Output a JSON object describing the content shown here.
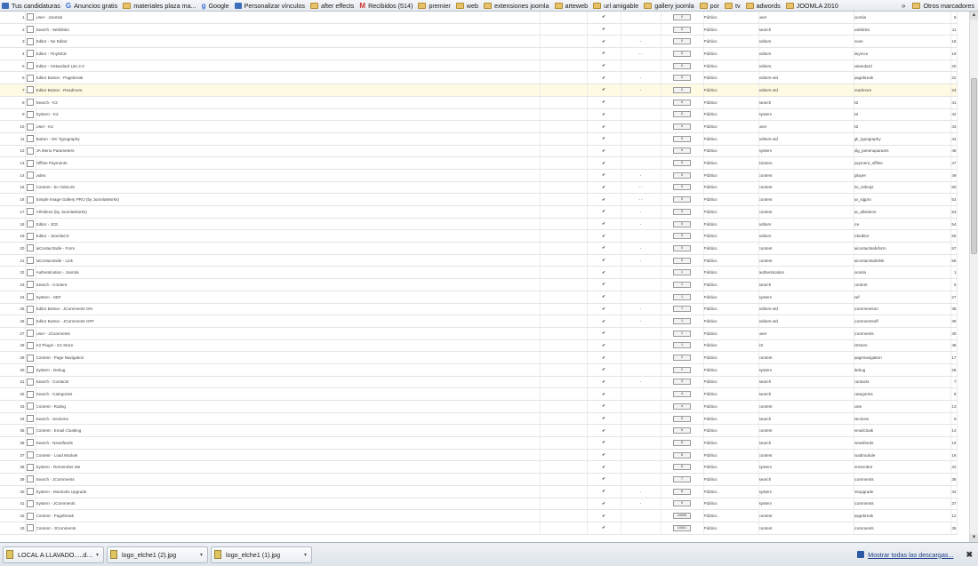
{
  "bookmarks": [
    {
      "icon": "joomla-icon",
      "label": "Tus candidaturas"
    },
    {
      "icon": "g-icon",
      "label": "Anuncios gratis"
    },
    {
      "icon": "folder-icon",
      "label": "materiales plaza ma..."
    },
    {
      "icon": "google-icon",
      "label": "Google"
    },
    {
      "icon": "star-icon",
      "label": "Personalizar vínculos"
    },
    {
      "icon": "folder-icon",
      "label": "after effects"
    },
    {
      "icon": "gmail-icon",
      "label": "Recibidos (514)"
    },
    {
      "icon": "folder-icon",
      "label": "premier"
    },
    {
      "icon": "folder-icon",
      "label": "web"
    },
    {
      "icon": "folder-icon",
      "label": "extensiones joomla"
    },
    {
      "icon": "folder-icon",
      "label": "arteweb"
    },
    {
      "icon": "folder-icon",
      "label": "url amigable"
    },
    {
      "icon": "folder-icon",
      "label": "gallery joomla"
    },
    {
      "icon": "folder-icon",
      "label": "por"
    },
    {
      "icon": "folder-icon",
      "label": "tv"
    },
    {
      "icon": "folder-icon",
      "label": "adwords"
    },
    {
      "icon": "folder-icon",
      "label": "JOOMLA 2010"
    }
  ],
  "bookmarks_overflow": "»",
  "other_bookmarks": "Otros marcadores",
  "plugins": [
    {
      "n": "1",
      "name": "User - Joomla!",
      "acc": "",
      "ord": "0",
      "pub": "Público",
      "folder": "user",
      "elem": "joomla",
      "id": "5"
    },
    {
      "n": "2",
      "name": "Search - Weblinks",
      "acc": "",
      "ord": "0",
      "pub": "Público",
      "folder": "search",
      "elem": "weblinks",
      "id": "11"
    },
    {
      "n": "3",
      "name": "Editor - No Editor",
      "acc": "-",
      "ord": "0",
      "pub": "Público",
      "folder": "editors",
      "elem": "none",
      "id": "18"
    },
    {
      "n": "4",
      "name": "Editor - TinyMCE",
      "acc": "- -",
      "ord": "0",
      "pub": "Público",
      "folder": "editors",
      "elem": "tinymce",
      "id": "19"
    },
    {
      "n": "5",
      "name": "Editor - XStandard Lite 2.0",
      "acc": "",
      "ord": "0",
      "pub": "Público",
      "folder": "editors",
      "elem": "xstandard",
      "id": "20"
    },
    {
      "n": "6",
      "name": "Editor Button - Pagebreak",
      "acc": "-",
      "ord": "0",
      "pub": "Público",
      "folder": "editors-xtd",
      "elem": "pagebreak",
      "id": "22"
    },
    {
      "n": "7",
      "name": "Editor Button - Readmore",
      "acc": "-",
      "ord": "0",
      "pub": "Público",
      "folder": "editors-xtd",
      "elem": "readmore",
      "id": "23"
    },
    {
      "n": "8",
      "name": "Search - K2",
      "acc": "",
      "ord": "0",
      "pub": "Público",
      "folder": "search",
      "elem": "k2",
      "id": "41"
    },
    {
      "n": "9",
      "name": "System - K2",
      "acc": "",
      "ord": "0",
      "pub": "Público",
      "folder": "system",
      "elem": "k2",
      "id": "42"
    },
    {
      "n": "10",
      "name": "User - K2",
      "acc": "",
      "ord": "0",
      "pub": "Público",
      "folder": "user",
      "elem": "k2",
      "id": "43"
    },
    {
      "n": "11",
      "name": "Button - GK Typography",
      "acc": "",
      "ord": "0",
      "pub": "Público",
      "folder": "editors-xtd",
      "elem": "gk_typography",
      "id": "44"
    },
    {
      "n": "12",
      "name": "JA Menu Parameters",
      "acc": "",
      "ord": "0",
      "pub": "Público",
      "folder": "system",
      "elem": "plg_jamenuparams",
      "id": "46"
    },
    {
      "n": "13",
      "name": "Offline Payments",
      "acc": "",
      "ord": "0",
      "pub": "Público",
      "folder": "k2store",
      "elem": "payment_offline",
      "id": "47"
    },
    {
      "n": "14",
      "name": "video",
      "acc": "-",
      "ord": "0",
      "pub": "Público",
      "folder": "content",
      "elem": "jplayer",
      "id": "49"
    },
    {
      "n": "15",
      "name": "Content - bo VideoJS",
      "acc": "- -",
      "ord": "0",
      "pub": "Público",
      "folder": "content",
      "elem": "bo_videojs",
      "id": "50"
    },
    {
      "n": "16",
      "name": "Simple Image Gallery PRO (by JoomlaWorks)",
      "acc": "- -",
      "ord": "0",
      "pub": "Público",
      "folder": "content",
      "elem": "jw_sigpro",
      "id": "52"
    },
    {
      "n": "17",
      "name": "AllVideos (by JoomlaWorks)",
      "acc": "-",
      "ord": "0",
      "pub": "Público",
      "folder": "content",
      "elem": "jw_allvideos",
      "id": "53"
    },
    {
      "n": "18",
      "name": "Editor - JCE",
      "acc": "-",
      "ord": "0",
      "pub": "Público",
      "folder": "editors",
      "elem": "jce",
      "id": "54"
    },
    {
      "n": "19",
      "name": "Editor - JoomlaCK",
      "acc": "",
      "ord": "0",
      "pub": "Público",
      "folder": "editors",
      "elem": "jckeditor",
      "id": "55"
    },
    {
      "n": "20",
      "name": "aiContactSafe - Form",
      "acc": "-",
      "ord": "0",
      "pub": "Público",
      "folder": "content",
      "elem": "aicontactsafeform",
      "id": "57"
    },
    {
      "n": "21",
      "name": "aiContactSafe - Link",
      "acc": "-",
      "ord": "0",
      "pub": "Público",
      "folder": "content",
      "elem": "aicontactsafelink",
      "id": "58"
    },
    {
      "n": "22",
      "name": "Authentication - Joomla",
      "acc": "",
      "ord": "1",
      "pub": "Público",
      "folder": "authentication",
      "elem": "joomla",
      "id": "1"
    },
    {
      "n": "23",
      "name": "Search - Content",
      "acc": "",
      "ord": "1",
      "pub": "Público",
      "folder": "search",
      "elem": "content",
      "id": "6"
    },
    {
      "n": "24",
      "name": "System - SEF",
      "acc": "",
      "ord": "1",
      "pub": "Público",
      "folder": "system",
      "elem": "sef",
      "id": "27"
    },
    {
      "n": "25",
      "name": "Editor Button - JComments ON",
      "acc": "-",
      "ord": "1",
      "pub": "Público",
      "folder": "editors-xtd",
      "elem": "jcommentson",
      "id": "38"
    },
    {
      "n": "26",
      "name": "Editor Button - JComments OFF",
      "acc": "-",
      "ord": "1",
      "pub": "Público",
      "folder": "editors-xtd",
      "elem": "jcommentsoff",
      "id": "39"
    },
    {
      "n": "27",
      "name": "User - JComments",
      "acc": "",
      "ord": "1",
      "pub": "Público",
      "folder": "user",
      "elem": "jcomments",
      "id": "40"
    },
    {
      "n": "28",
      "name": "K2 Plugin - K2 Store",
      "acc": "",
      "ord": "1",
      "pub": "Público",
      "folder": "k2",
      "elem": "k2store",
      "id": "48"
    },
    {
      "n": "29",
      "name": "Content - Page Navigation",
      "acc": "",
      "ord": "2",
      "pub": "Público",
      "folder": "content",
      "elem": "pagenavigation",
      "id": "17"
    },
    {
      "n": "30",
      "name": "System - Debug",
      "acc": "",
      "ord": "2",
      "pub": "Público",
      "folder": "system",
      "elem": "debug",
      "id": "28"
    },
    {
      "n": "31",
      "name": "Search - Contacts",
      "acc": "-",
      "ord": "3",
      "pub": "Público",
      "folder": "search",
      "elem": "contacts",
      "id": "7"
    },
    {
      "n": "32",
      "name": "Search - Categories",
      "acc": "",
      "ord": "4",
      "pub": "Público",
      "folder": "search",
      "elem": "categories",
      "id": "8"
    },
    {
      "n": "33",
      "name": "Content - Rating",
      "acc": "",
      "ord": "4",
      "pub": "Público",
      "folder": "content",
      "elem": "vote",
      "id": "13"
    },
    {
      "n": "34",
      "name": "Search - Sections",
      "acc": "",
      "ord": "5",
      "pub": "Público",
      "folder": "search",
      "elem": "sections",
      "id": "9"
    },
    {
      "n": "35",
      "name": "Content - Email Cloaking",
      "acc": "",
      "ord": "5",
      "pub": "Público",
      "folder": "content",
      "elem": "emailcloak",
      "id": "14"
    },
    {
      "n": "36",
      "name": "Search - Newsfeeds",
      "acc": "",
      "ord": "6",
      "pub": "Público",
      "folder": "search",
      "elem": "newsfeeds",
      "id": "10"
    },
    {
      "n": "37",
      "name": "Content - Load Module",
      "acc": "",
      "ord": "6",
      "pub": "Público",
      "folder": "content",
      "elem": "loadmodule",
      "id": "16"
    },
    {
      "n": "38",
      "name": "System - Remember Me",
      "acc": "",
      "ord": "6",
      "pub": "Público",
      "folder": "system",
      "elem": "remember",
      "id": "32"
    },
    {
      "n": "39",
      "name": "Search - JComments",
      "acc": "",
      "ord": "7",
      "pub": "Público",
      "folder": "search",
      "elem": "jcomments",
      "id": "36"
    },
    {
      "n": "40",
      "name": "System - Mootools Upgrade",
      "acc": "-",
      "ord": "8",
      "pub": "Público",
      "folder": "system",
      "elem": "mtupgrade",
      "id": "34"
    },
    {
      "n": "41",
      "name": "System - JComments",
      "acc": "-",
      "ord": "9",
      "pub": "Público",
      "folder": "system",
      "elem": "jcomments",
      "id": "37"
    },
    {
      "n": "42",
      "name": "Content - Pagebreak",
      "acc": "",
      "ord": "10000",
      "pub": "Público",
      "folder": "content",
      "elem": "pagebreak",
      "id": "12"
    },
    {
      "n": "43",
      "name": "Content - JComments",
      "acc": "",
      "ord": "10001",
      "pub": "Público",
      "folder": "content",
      "elem": "jcomments",
      "id": "35"
    }
  ],
  "enabled_glyph": "✔",
  "downloads": [
    {
      "label": "LOCAL A LLAVADO.....dwg"
    },
    {
      "label": "logo_elche1 (2).jpg"
    },
    {
      "label": "logo_elche1 (1).jpg"
    }
  ],
  "download_arrow": "▾",
  "show_all_downloads": "Mostrar todas las descargas...",
  "close_shelf": "✖",
  "colors": {
    "enabled": "#3aa52b",
    "published": "#3e9b1f",
    "link": "#1b4f9a",
    "highlight": "#fffbe3"
  }
}
